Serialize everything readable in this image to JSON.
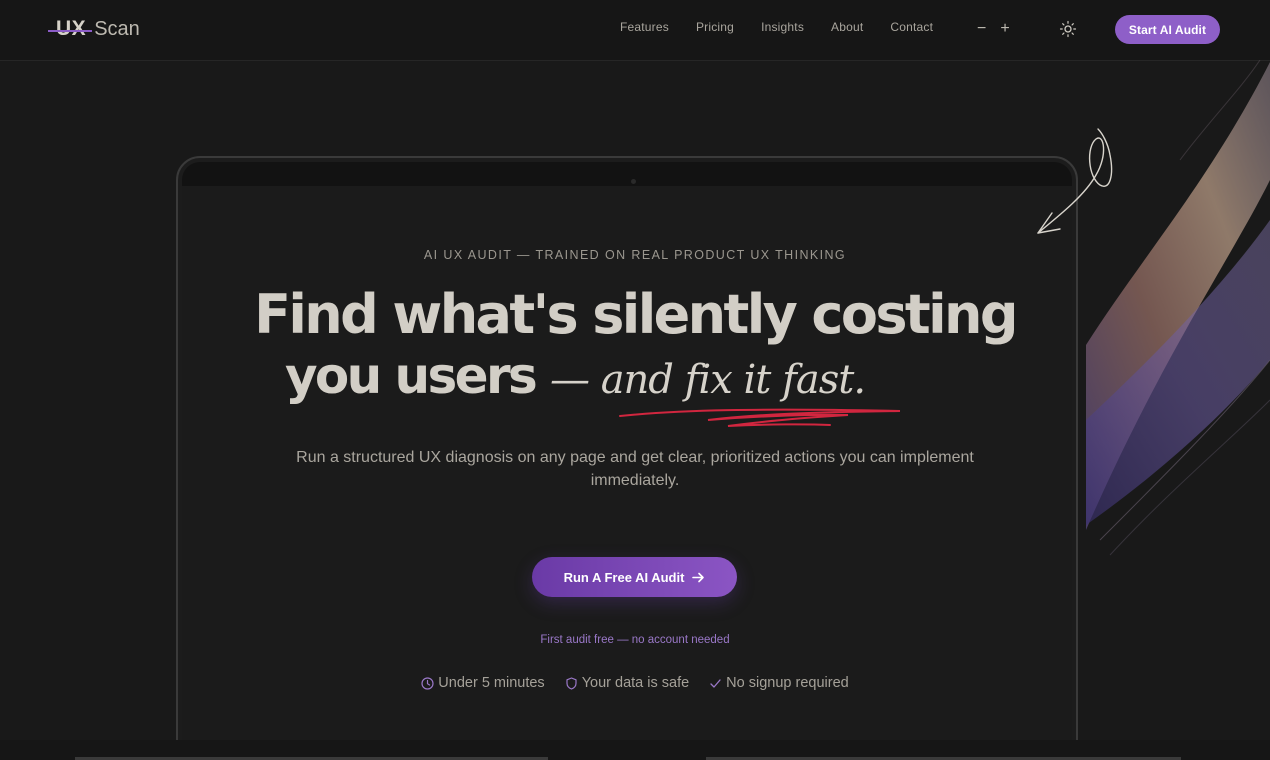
{
  "brand": {
    "mark": "UX",
    "word": "Scan"
  },
  "nav": {
    "items": [
      "Features",
      "Pricing",
      "Insights",
      "About",
      "Contact"
    ],
    "zoom_out": "−",
    "zoom_in": "+",
    "theme_icon": "sun-icon",
    "cta_label": "Start AI Audit"
  },
  "hero": {
    "eyebrow": "AI UX AUDIT — TRAINED ON REAL PRODUCT UX THINKING",
    "headline_line1": "Find what's silently costing",
    "headline_line2": "you users",
    "headline_italic": "— and fix it fast.",
    "subtitle": "Run a structured UX diagnosis on any page and get clear, prioritized actions you can implement immediately.",
    "cta_label": "Run A Free AI Audit",
    "cta_icon": "arrow-right-icon",
    "note": "First audit free — no account needed",
    "badges": [
      {
        "icon": "clock-icon",
        "label": "Under 5 minutes"
      },
      {
        "icon": "shield-icon",
        "label": "Your data is safe"
      },
      {
        "icon": "check-icon",
        "label": "No signup required"
      }
    ]
  },
  "colors": {
    "background": "#191919",
    "accent": "#8e5fc8",
    "underline": "#d1263f",
    "text": "#d2cec6"
  }
}
